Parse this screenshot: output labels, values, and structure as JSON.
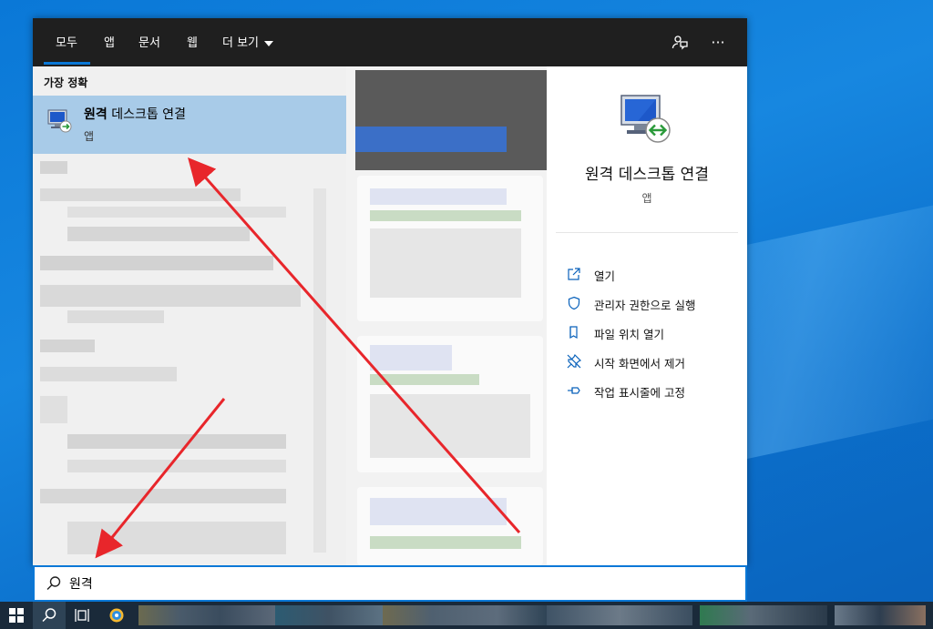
{
  "tabs": [
    {
      "label": "모두"
    },
    {
      "label": "앱"
    },
    {
      "label": "문서"
    },
    {
      "label": "웹"
    },
    {
      "label": "더 보기"
    }
  ],
  "topbar_icons": {
    "feedback": "feedback-icon",
    "more": "ellipsis-icon",
    "more_glyph": "···"
  },
  "left": {
    "section_title": "가장 정확",
    "best_match": {
      "name_bold": "원격",
      "name_rest": " 데스크톱 연결",
      "type": "앱"
    }
  },
  "right": {
    "title": "원격 데스크톱 연결",
    "subtitle": "앱",
    "actions": [
      {
        "label": "열기",
        "icon": "open-icon"
      },
      {
        "label": "관리자 권한으로 실행",
        "icon": "shield-icon"
      },
      {
        "label": "파일 위치 열기",
        "icon": "file-location-icon"
      },
      {
        "label": "시작 화면에서 제거",
        "icon": "unpin-icon"
      },
      {
        "label": "작업 표시줄에 고정",
        "icon": "pin-icon"
      }
    ]
  },
  "search": {
    "value": "원격",
    "icon": "search-icon"
  },
  "colors": {
    "accent": "#0a78d7",
    "selection": "#a8cbe8",
    "arrow": "#e8262b",
    "topbar": "#1f1f1f"
  }
}
